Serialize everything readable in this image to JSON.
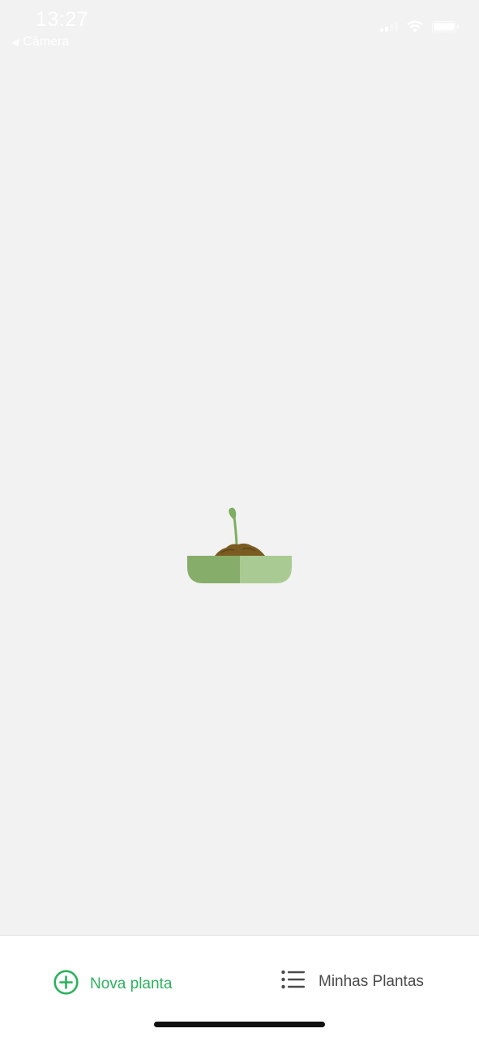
{
  "status_bar": {
    "time": "13:27",
    "back_app_label": "Câmera",
    "icons": [
      "signal-icon",
      "wifi-icon",
      "battery-icon"
    ]
  },
  "illustration": {
    "name": "plant-seedling-illustration",
    "colors": {
      "bowl_left": "#87ad6a",
      "bowl_right": "#a9cb93",
      "soil": "#7a5c22",
      "sprout": "#7fae61"
    }
  },
  "tab_bar": {
    "new_plant_label": "Nova planta",
    "my_plants_label": "Minhas Plantas",
    "new_plant_icon": "plus-circle-icon",
    "my_plants_icon": "list-icon"
  },
  "colors": {
    "background": "#f2f2f2",
    "accent": "#2bb25d",
    "tab_text": "#4a4a4a"
  }
}
